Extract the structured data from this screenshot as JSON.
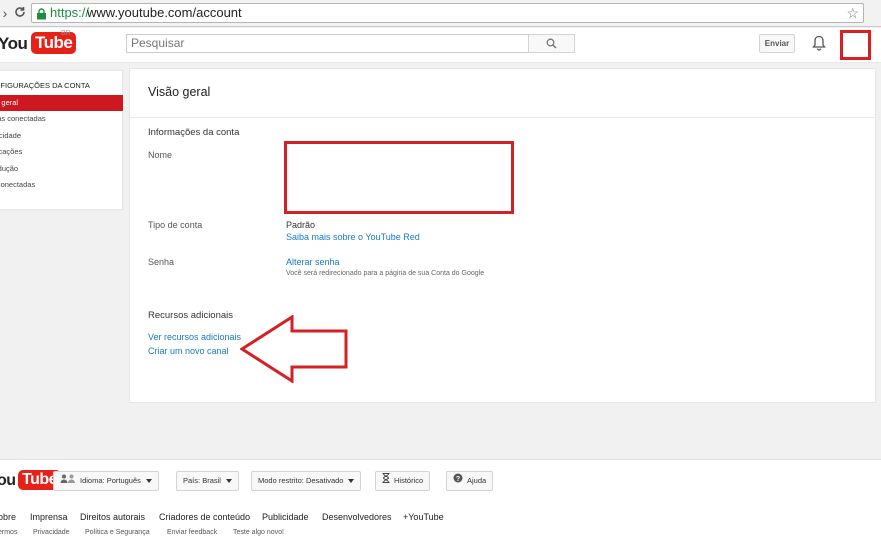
{
  "browser": {
    "url_scheme": "https://",
    "url_rest": "www.youtube.com/account"
  },
  "header": {
    "logo_you": "You",
    "logo_tube": "Tube",
    "logo_country": "BR",
    "search_placeholder": "Pesquisar",
    "upload_label": "Enviar"
  },
  "sidebar": {
    "heading": "NFIGURAÇÕES DA CONTA",
    "items": [
      {
        "label": "ão geral",
        "active": true
      },
      {
        "label": "ntas conectadas"
      },
      {
        "label": "vacidade"
      },
      {
        "label": "tificações"
      },
      {
        "label": "rodução"
      },
      {
        "label": "s conectadas"
      }
    ]
  },
  "main": {
    "title": "Visão geral",
    "account_info_heading": "Informações da conta",
    "name_label": "Nome",
    "account_type_label": "Tipo de conta",
    "account_type_value": "Padrão",
    "youtube_red_link": "Saiba mais sobre o YouTube Red",
    "password_label": "Senha",
    "change_password_link": "Alterar senha",
    "password_note": "Você será redirecionado para a página de sua Conta do Google",
    "additional_heading": "Recursos adicionais",
    "see_additional_link": "Ver recursos adicionais",
    "create_channel_link": "Criar um novo canal"
  },
  "footer": {
    "logo_you": "You",
    "logo_tube": "Tube",
    "language_label": "Idioma:",
    "language_value": "Português",
    "country_label": "País:",
    "country_value": "Brasil",
    "restricted_label": "Modo restrito:",
    "restricted_value": "Desativado",
    "history_label": "Histórico",
    "help_label": "Ajuda",
    "links": [
      "obre",
      "Imprensa",
      "Direitos autorais",
      "Criadores de conteúdo",
      "Publicidade",
      "Desenvolvedores",
      "+YouTube"
    ],
    "small_links": [
      "ermos",
      "Privacidade",
      "Política e Segurança",
      "Enviar feedback",
      "Teste algo novo!"
    ]
  },
  "colors": {
    "accent_red": "#cc181e",
    "annotation_red": "#d32125",
    "link_blue": "#167ac6"
  }
}
